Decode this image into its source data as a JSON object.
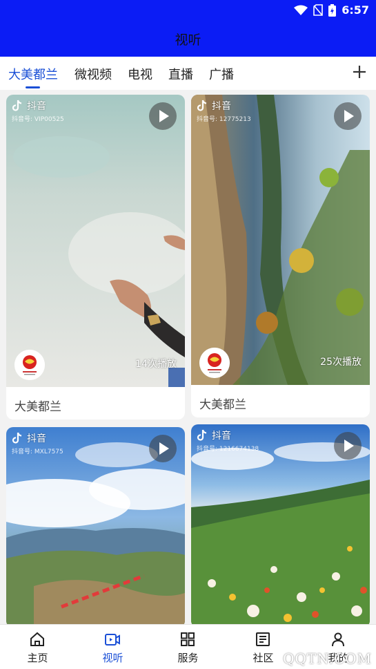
{
  "status_bar": {
    "time": "6:57",
    "icons": [
      "wifi-icon",
      "no-sim-icon",
      "battery-charging-icon"
    ],
    "background": "#0b1cf5"
  },
  "header": {
    "title": "视听"
  },
  "tabs": {
    "items": [
      {
        "label": "大美都兰",
        "active": true
      },
      {
        "label": "微视频",
        "active": false
      },
      {
        "label": "电视",
        "active": false
      },
      {
        "label": "直播",
        "active": false
      },
      {
        "label": "广播",
        "active": false
      }
    ],
    "add_icon": "plus-icon",
    "accent": "#1a4fd6"
  },
  "videos": [
    {
      "platform": "抖音",
      "account": "抖音号: VIP00525",
      "views": "14次播放",
      "caption": "大美都兰",
      "scene": "sand-with-hand"
    },
    {
      "platform": "抖音",
      "account": "抖音号: 12775213",
      "views": "25次播放",
      "caption": "大美都兰",
      "scene": "lake-cliff-leaves"
    },
    {
      "platform": "抖音",
      "account": "抖音号: MXL7575",
      "views": "",
      "caption": "",
      "scene": "sky-mountains-village"
    },
    {
      "platform": "抖音",
      "account": "抖音号: 1216674138",
      "views": "",
      "caption": "",
      "scene": "flower-meadow"
    }
  ],
  "bottom_nav": [
    {
      "label": "主页",
      "icon": "home-icon",
      "active": false
    },
    {
      "label": "视听",
      "icon": "video-icon",
      "active": true
    },
    {
      "label": "服务",
      "icon": "grid-icon",
      "active": false
    },
    {
      "label": "社区",
      "icon": "newspaper-icon",
      "active": false
    },
    {
      "label": "我的",
      "icon": "user-icon",
      "active": false
    }
  ],
  "watermark": "QQTN.COM"
}
